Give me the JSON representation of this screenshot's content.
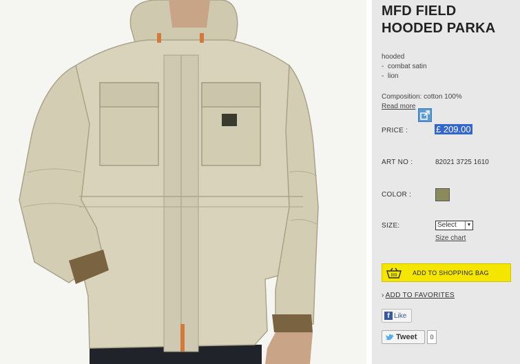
{
  "product": {
    "title_line1": "MFD FIELD",
    "title_line2": "HOODED PARKA",
    "description": [
      "hooded",
      "-  combat satin",
      "-  lion"
    ],
    "composition": "Composition: cotton 100%",
    "read_more": "Read more",
    "price_label": "PRICE :",
    "price": "£ 209.00",
    "art_label": "ART NO :",
    "art_no": "82021 3725 1610",
    "color_label": "COLOR :",
    "color_swatch": "#8a8a5a",
    "size_label": "SIZE:",
    "size_selected": "Select",
    "size_chart": "Size chart"
  },
  "actions": {
    "add_to_bag": "ADD TO SHOPPING BAG",
    "add_to_favorites": "ADD TO FAVORITES",
    "fb_like": "Like",
    "tweet": "Tweet",
    "tweet_count": "0"
  },
  "colors": {
    "panel_bg": "#e8e8e8",
    "bag_button": "#f5e600",
    "price_highlight": "#3366cc",
    "jacket": "#d8d2ba"
  }
}
